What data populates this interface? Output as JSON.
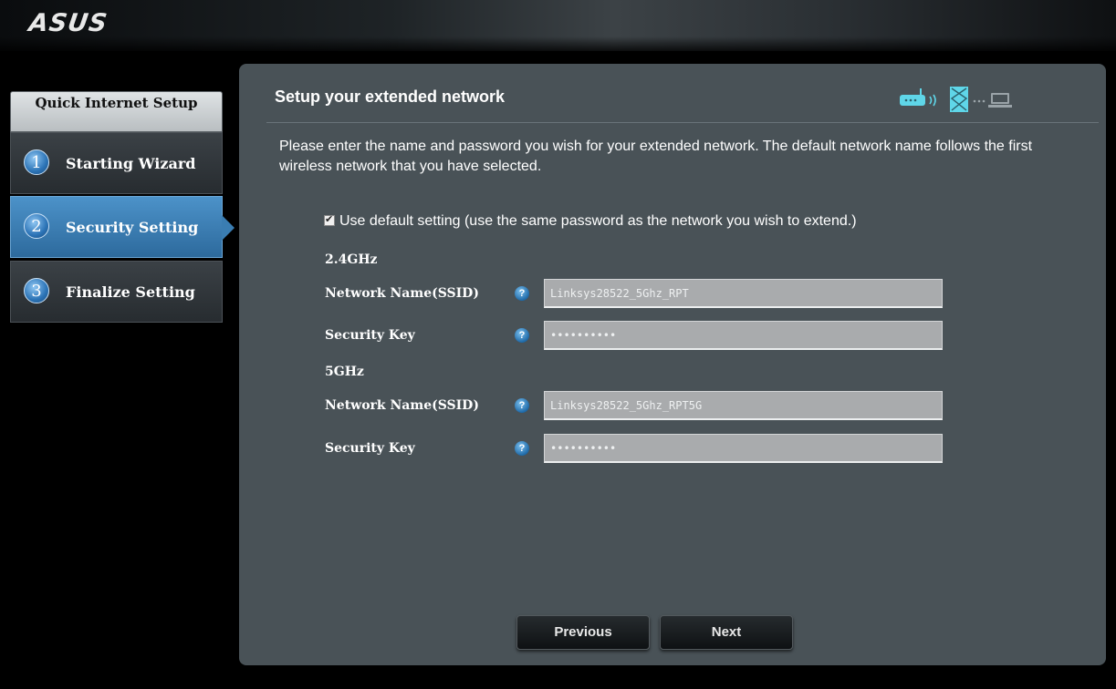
{
  "brand": {
    "logo": "ASUS"
  },
  "sidebar": {
    "header": "Quick Internet Setup",
    "steps": [
      {
        "number": "1",
        "label": "Starting Wizard",
        "active": false
      },
      {
        "number": "2",
        "label": "Security Setting",
        "active": true
      },
      {
        "number": "3",
        "label": "Finalize Setting",
        "active": false
      }
    ]
  },
  "main": {
    "title": "Setup your extended network",
    "description": "Please enter the name and password you wish for your extended network. The default network name follows the first wireless network that you have selected.",
    "default_checkbox": {
      "label": "Use default setting (use the same password as the network you wish to extend.)",
      "checked": true
    },
    "bands": [
      {
        "label": "2.4GHz",
        "ssid_label": "Network Name(SSID)",
        "ssid_value": "Linksys28522_5Ghz_RPT",
        "key_label": "Security Key",
        "key_value": "••••••••••"
      },
      {
        "label": "5GHz",
        "ssid_label": "Network Name(SSID)",
        "ssid_value": "Linksys28522_5Ghz_RPT5G",
        "key_label": "Security Key",
        "key_value": "••••••••••"
      }
    ],
    "help_glyph": "?",
    "buttons": {
      "previous": "Previous",
      "next": "Next"
    }
  },
  "icons": {
    "topology": [
      "router-icon",
      "wifi-signal-icon",
      "repeater-icon",
      "laptop-icon"
    ]
  },
  "colors": {
    "panel_bg": "#495257",
    "active_step": "#3a7db2",
    "field_bg": "#a9abad"
  }
}
